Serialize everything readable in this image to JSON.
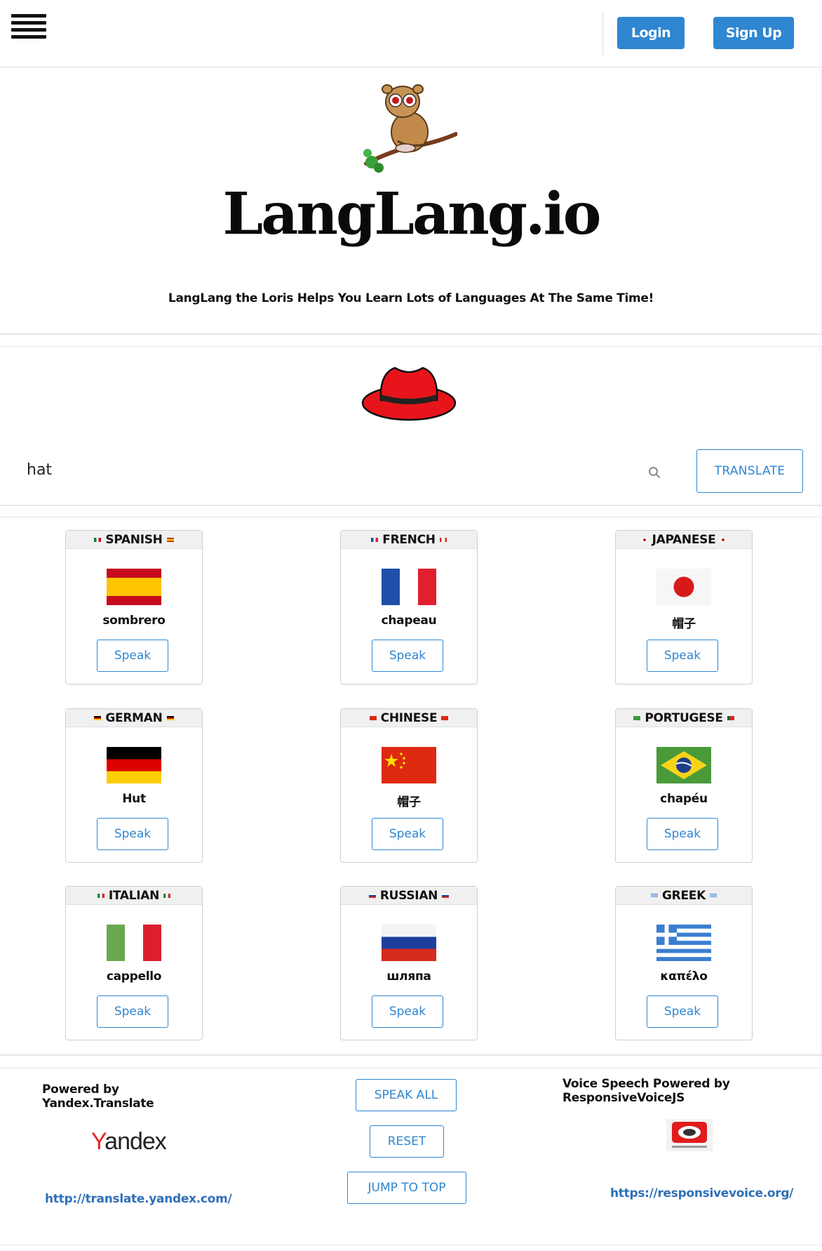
{
  "nav": {
    "login_label": "Login",
    "signup_label": "Sign Up"
  },
  "hero": {
    "brand": "LangLang.io",
    "tagline": "LangLang the Loris Helps You Learn Lots of Languages At The Same Time!"
  },
  "search": {
    "value": "hat",
    "translate_label": "TRANSLATE"
  },
  "cards": [
    {
      "language": "SPANISH",
      "word": "sombrero",
      "speak_label": "Speak",
      "flag": "spain-flag"
    },
    {
      "language": "FRENCH",
      "word": "chapeau",
      "speak_label": "Speak",
      "flag": "france-flag"
    },
    {
      "language": "JAPANESE",
      "word": "帽子",
      "speak_label": "Speak",
      "flag": "japan-flag"
    },
    {
      "language": "GERMAN",
      "word": "Hut",
      "speak_label": "Speak",
      "flag": "germany-flag"
    },
    {
      "language": "CHINESE",
      "word": "帽子",
      "speak_label": "Speak",
      "flag": "china-flag"
    },
    {
      "language": "PORTUGESE",
      "word": "chapéu",
      "speak_label": "Speak",
      "flag": "brazil-flag"
    },
    {
      "language": "ITALIAN",
      "word": "cappello",
      "speak_label": "Speak",
      "flag": "italy-flag"
    },
    {
      "language": "RUSSIAN",
      "word": "шляпа",
      "speak_label": "Speak",
      "flag": "russia-flag"
    },
    {
      "language": "GREEK",
      "word": "καπέλο",
      "speak_label": "Speak",
      "flag": "greece-flag"
    }
  ],
  "footer": {
    "left_title": "Powered by Yandex.Translate",
    "yandex_logo_text": "Yandex",
    "left_link": "http://translate.yandex.com/",
    "speak_all_label": "SPEAK ALL",
    "reset_label": "RESET",
    "jump_label": "JUMP TO TOP",
    "right_title": "Voice Speech Powered by ResponsiveVoiceJS",
    "right_link": "https://responsivevoice.org/"
  },
  "colors": {
    "accent": "#2f86d1",
    "link": "#2f6fb7",
    "hat": "#e8141b"
  }
}
